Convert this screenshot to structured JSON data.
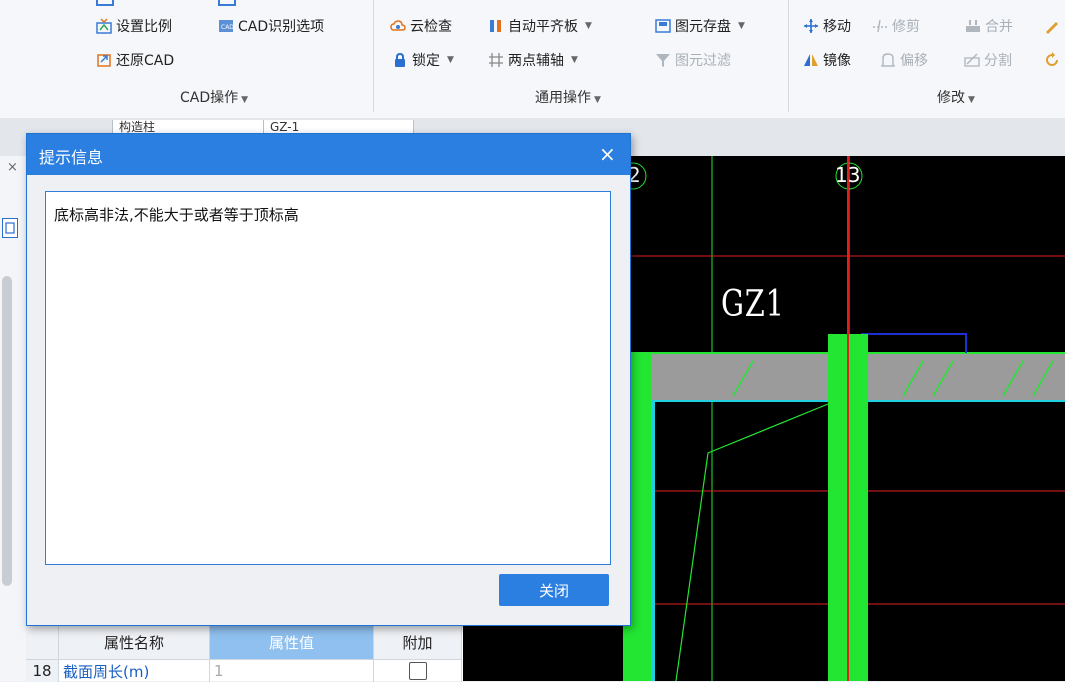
{
  "ribbon": {
    "cad_group": {
      "set_scale": "设置比例",
      "cad_recognize_options": "CAD识别选项",
      "restore_cad": "还原CAD",
      "label": "CAD操作"
    },
    "general_group": {
      "cloud_check": "云检查",
      "auto_align": "自动平齐板",
      "lock": "锁定",
      "two_point_axis": "两点辅轴",
      "element_save": "图元存盘",
      "element_filter": "图元过滤",
      "label": "通用操作"
    },
    "modify_group": {
      "move": "移动",
      "trim": "修剪",
      "merge": "合并",
      "mirror": "镜像",
      "offset": "偏移",
      "split": "分割",
      "label": "修改"
    }
  },
  "tabstrip": {
    "combo1": "构造柱",
    "combo2": "GZ-1"
  },
  "dialog": {
    "title": "提示信息",
    "close_x": "×",
    "message": "底标高非法,不能大于或者等于顶标高",
    "close_button": "关闭"
  },
  "property_grid": {
    "headers": {
      "name": "属性名称",
      "value": "属性值",
      "extra": "附加"
    },
    "rows": [
      {
        "index": "18",
        "name": "截面周长(m)",
        "value": "1"
      }
    ]
  },
  "canvas": {
    "axis_labels": [
      "2",
      "13"
    ],
    "element_label": "GZ1"
  },
  "colors": {
    "dialog_title_bar": "#2b7fe0",
    "canvas_bg": "#000000",
    "column_green": "#22e632",
    "axis_red": "#e02020"
  }
}
